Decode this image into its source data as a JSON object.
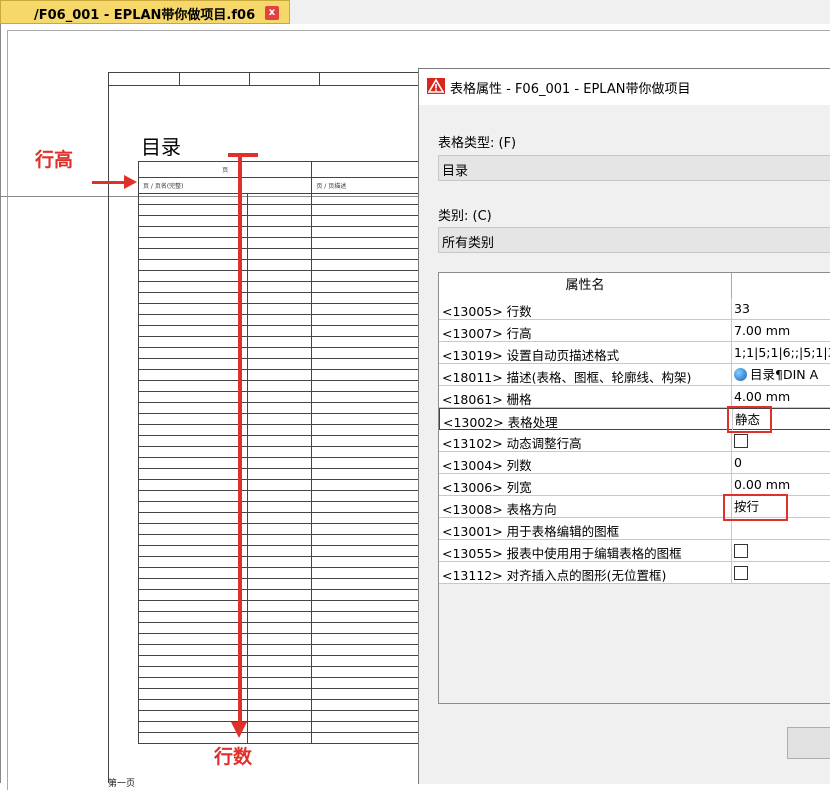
{
  "document_tab": {
    "title": "/F06_001 - EPLAN带你做项目.f06",
    "close_symbol": "x"
  },
  "sheet": {
    "title": "目录",
    "header_page": "页",
    "col_page_name": "页 / 页名(完整)",
    "col_page_desc": "页 / 页描述",
    "footer": "第一页"
  },
  "annotations": {
    "row_height_label": "行高",
    "row_count_label": "行数",
    "color": "#e0302a"
  },
  "dialog": {
    "title": "表格属性 - F06_001 - EPLAN带你做项目",
    "table_type_label": "表格类型: (F)",
    "table_type_value": "目录",
    "category_label": "类别: (C)",
    "category_value": "所有类别",
    "grid_header_name": "属性名",
    "properties": [
      {
        "name": "<13005> 行数",
        "value": "33",
        "kind": "text"
      },
      {
        "name": "<13007> 行高",
        "value": "7.00 mm",
        "kind": "text"
      },
      {
        "name": "<13019> 设置自动页描述格式",
        "value": "1;1|5;1|6;;|5;1|3;1",
        "kind": "text"
      },
      {
        "name": "<18011> 描述(表格、图框、轮廓线、构架)",
        "value": "目录¶DIN A",
        "kind": "globe"
      },
      {
        "name": "<18061> 栅格",
        "value": "4.00 mm",
        "kind": "text"
      },
      {
        "name": "<13002> 表格处理",
        "value": "静态",
        "kind": "text"
      },
      {
        "name": "<13102> 动态调整行高",
        "value": "",
        "kind": "checkbox"
      },
      {
        "name": "<13004> 列数",
        "value": "0",
        "kind": "text"
      },
      {
        "name": "<13006> 列宽",
        "value": "0.00 mm",
        "kind": "text"
      },
      {
        "name": "<13008> 表格方向",
        "value": "按行",
        "kind": "text"
      },
      {
        "name": "<13001> 用于表格编辑的图框",
        "value": "",
        "kind": "text"
      },
      {
        "name": "<13055> 报表中使用用于编辑表格的图框",
        "value": "",
        "kind": "checkbox"
      },
      {
        "name": "<13112> 对齐插入点的图形(无位置框)",
        "value": "",
        "kind": "checkbox"
      }
    ]
  }
}
